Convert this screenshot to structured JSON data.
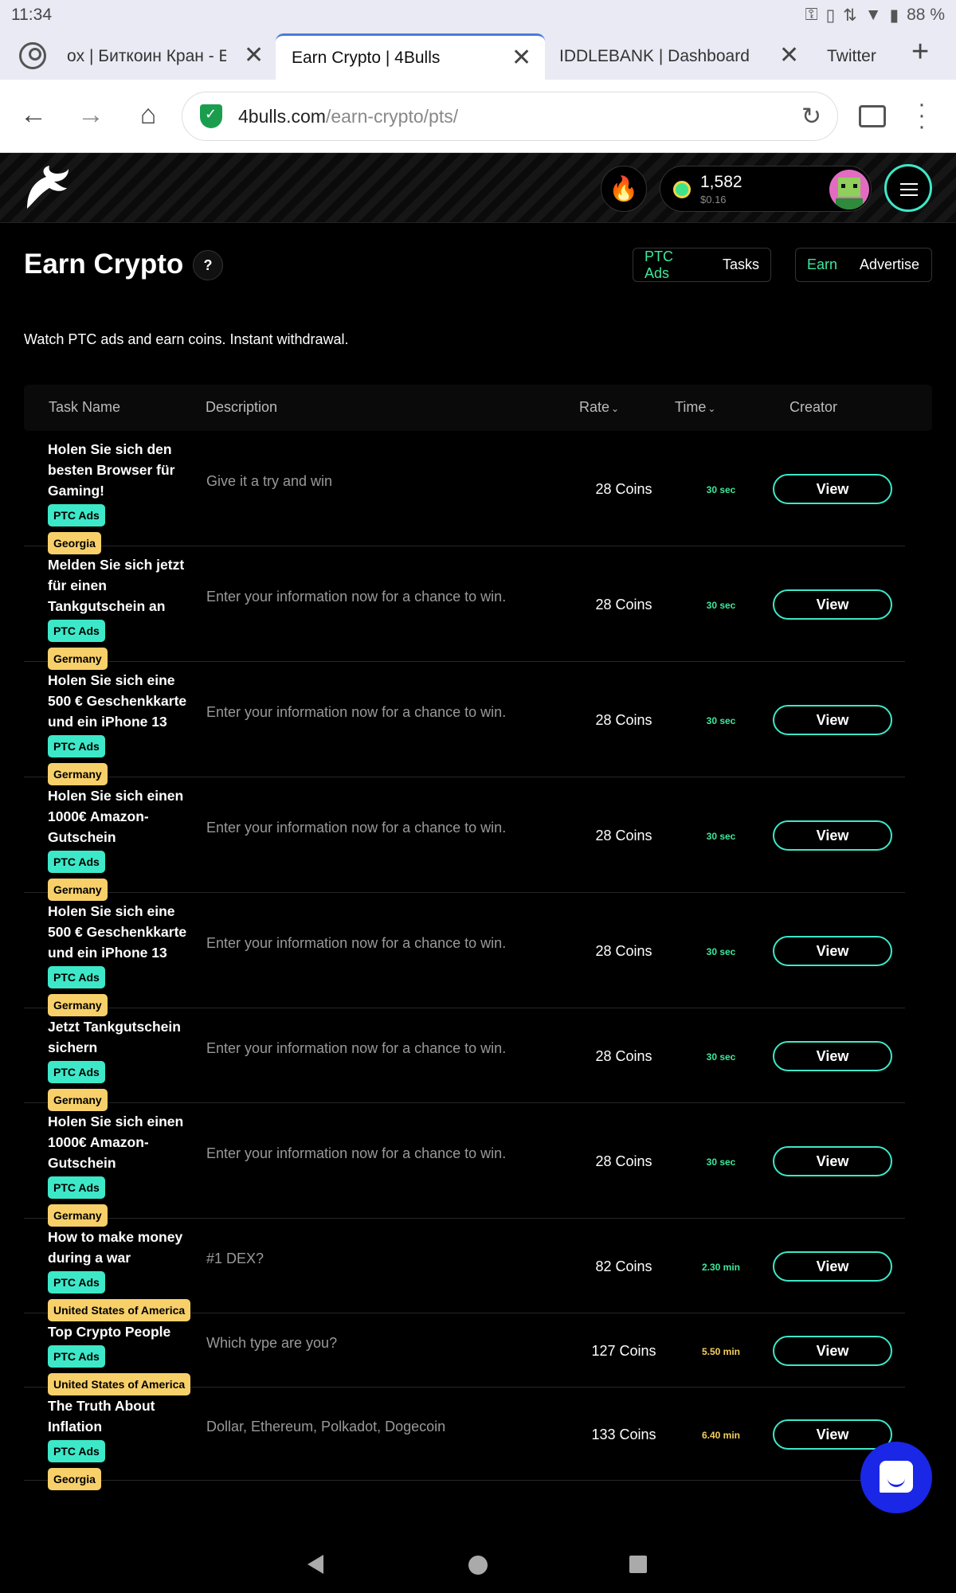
{
  "status_bar": {
    "time": "11:34",
    "battery": "88 %"
  },
  "browser": {
    "tabs": [
      {
        "label": "ox | Биткоин Кран - Бе"
      },
      {
        "label": "Earn Crypto | 4Bulls"
      },
      {
        "label": "IDDLEBANK | Dashboard"
      },
      {
        "label": "Twitter"
      }
    ],
    "url_domain": "4bulls.com",
    "url_path": "/earn-crypto/pts/"
  },
  "header": {
    "balance": "1,582",
    "balance_usd": "$0.16"
  },
  "page": {
    "title": "Earn Crypto",
    "help": "?",
    "toggle_type": {
      "ptc": "PTC Ads",
      "tasks": "Tasks"
    },
    "toggle_mode": {
      "earn": "Earn",
      "advertise": "Advertise"
    },
    "subtitle": "Watch PTC ads and earn coins. Instant withdrawal."
  },
  "table": {
    "columns": {
      "task_name": "Task Name",
      "description": "Description",
      "rate": "Rate",
      "time": "Time",
      "creator": "Creator"
    },
    "view_label": "View",
    "rows": [
      {
        "name": "Holen Sie sich den besten Browser für Gaming!",
        "type": "PTC Ads",
        "geo": "Georgia",
        "description": "Give it a try and win",
        "rate": "28 Coins",
        "time": "30 sec",
        "time_color": "green"
      },
      {
        "name": "Melden Sie sich jetzt für einen Tankgutschein an",
        "type": "PTC Ads",
        "geo": "Germany",
        "description": "Enter your information now for a chance to win.",
        "rate": "28 Coins",
        "time": "30 sec",
        "time_color": "green"
      },
      {
        "name": "Holen Sie sich eine 500 € Geschenkkarte und ein iPhone 13",
        "type": "PTC Ads",
        "geo": "Germany",
        "description": "Enter your information now for a chance to win.",
        "rate": "28 Coins",
        "time": "30 sec",
        "time_color": "green"
      },
      {
        "name": "Holen Sie sich einen 1000€ Amazon-Gutschein",
        "type": "PTC Ads",
        "geo": "Germany",
        "description": "Enter your information now for a chance to win.",
        "rate": "28 Coins",
        "time": "30 sec",
        "time_color": "green"
      },
      {
        "name": "Holen Sie sich eine 500 € Geschenkkarte und ein iPhone 13",
        "type": "PTC Ads",
        "geo": "Germany",
        "description": "Enter your information now for a chance to win.",
        "rate": "28 Coins",
        "time": "30 sec",
        "time_color": "green"
      },
      {
        "name": "Jetzt Tankgutschein sichern",
        "type": "PTC Ads",
        "geo": "Germany",
        "description": "Enter your information now for a chance to win.",
        "rate": "28 Coins",
        "time": "30 sec",
        "time_color": "green"
      },
      {
        "name": "Holen Sie sich einen 1000€ Amazon-Gutschein",
        "type": "PTC Ads",
        "geo": "Germany",
        "description": "Enter your information now for a chance to win.",
        "rate": "28 Coins",
        "time": "30 sec",
        "time_color": "green"
      },
      {
        "name": "How to make money during a war",
        "type": "PTC Ads",
        "geo": "United States of America",
        "description": "#1 DEX?",
        "rate": "82 Coins",
        "time": "2.30 min",
        "time_color": "green"
      },
      {
        "name": "Top Crypto People",
        "type": "PTC Ads",
        "geo": "United States of America",
        "description": "Which type are you?",
        "rate": "127 Coins",
        "time": "5.50 min",
        "time_color": "yellow"
      },
      {
        "name": "The Truth About Inflation",
        "type": "PTC Ads",
        "geo": "Georgia",
        "description": "Dollar, Ethereum, Polkadot, Dogecoin",
        "rate": "133 Coins",
        "time": "6.40 min",
        "time_color": "yellow"
      }
    ]
  },
  "colors": {
    "accent": "#3de8c8",
    "green": "#3de89c",
    "yellow": "#f5d05a",
    "chat": "#1a27e6"
  }
}
